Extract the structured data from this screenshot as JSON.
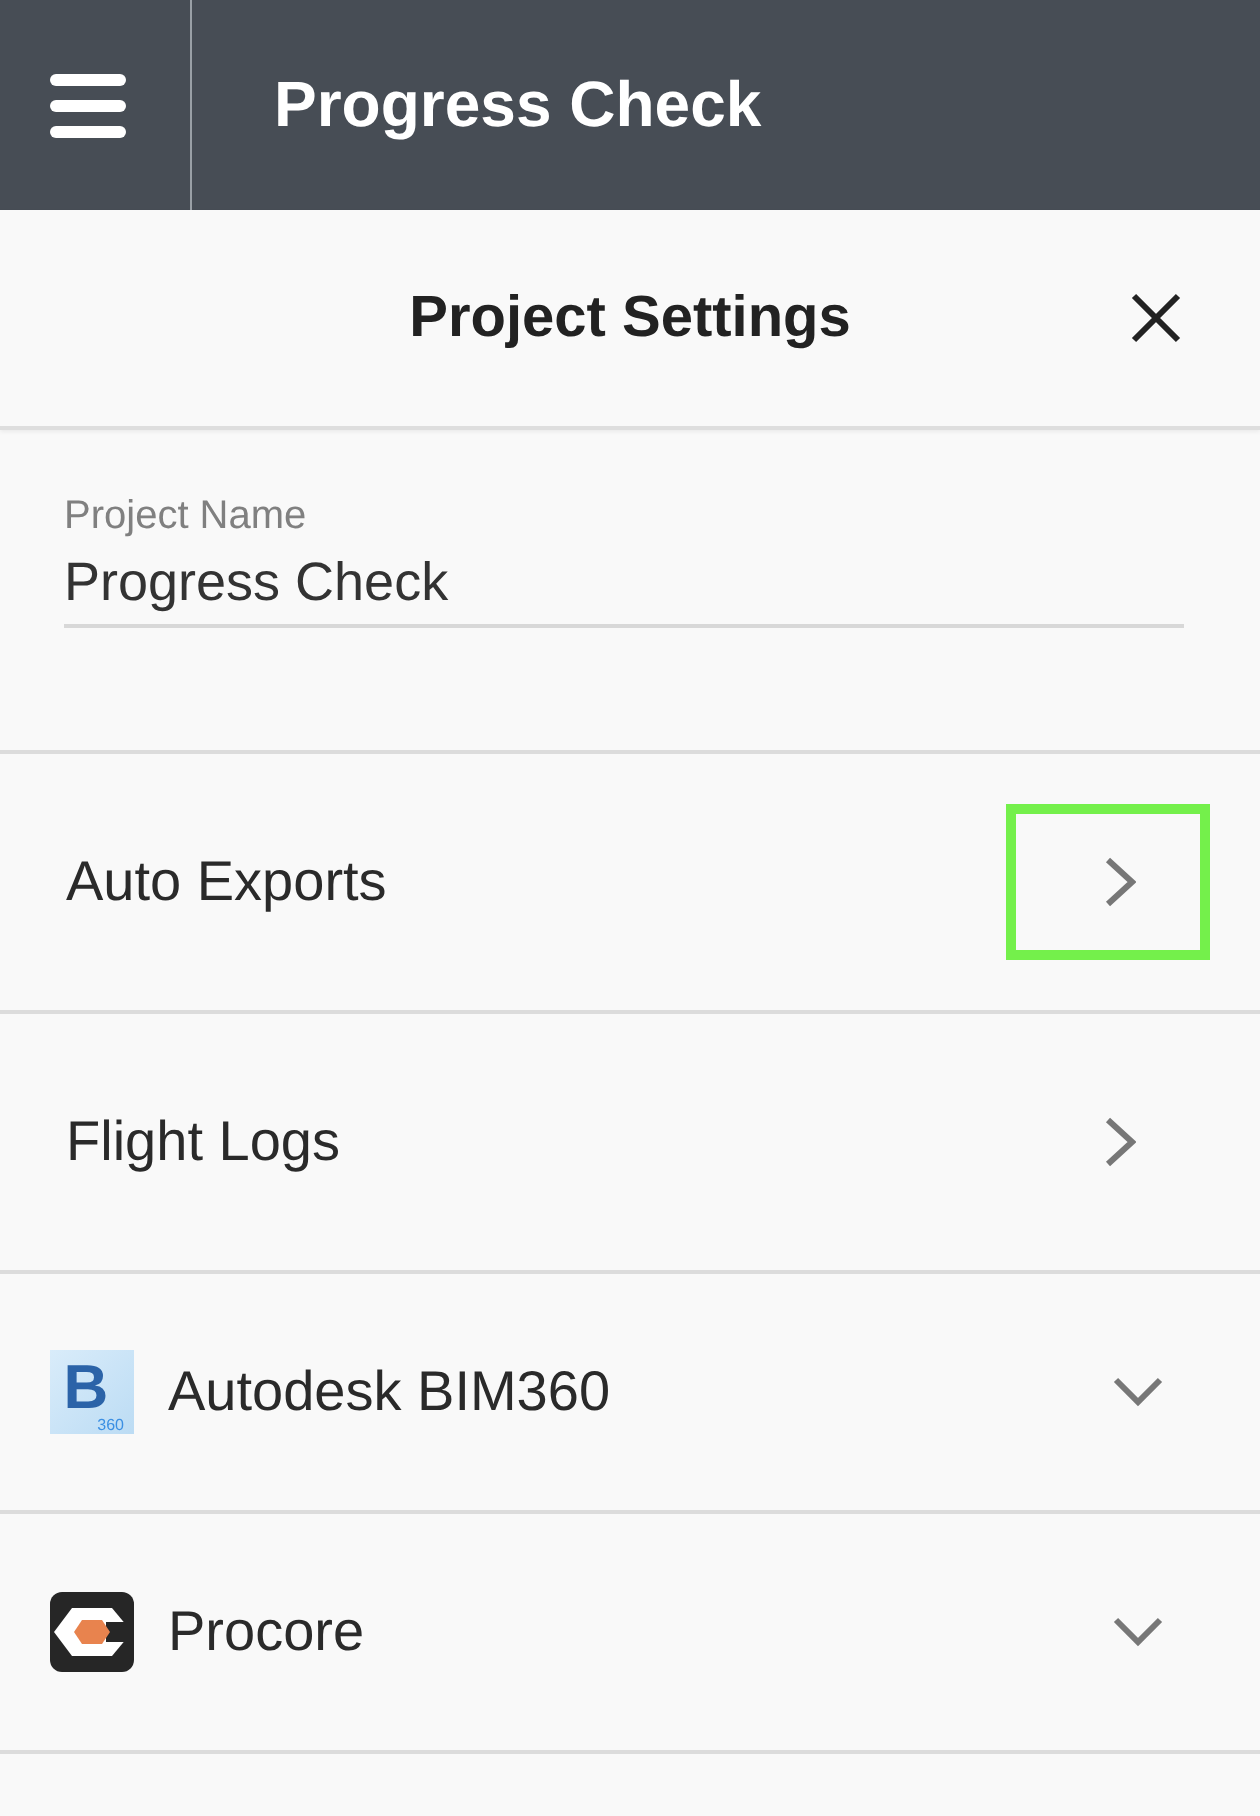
{
  "header": {
    "title": "Progress Check"
  },
  "panel": {
    "title": "Project Settings"
  },
  "project_name": {
    "label": "Project Name",
    "value": "Progress Check"
  },
  "items": [
    {
      "kind": "link",
      "label": "Auto Exports",
      "highlighted": true
    },
    {
      "kind": "link",
      "label": "Flight Logs",
      "highlighted": false
    },
    {
      "kind": "integration",
      "label": "Autodesk BIM360",
      "logo": {
        "kind": "letter-tile",
        "letter": "B",
        "caption": "360"
      },
      "expanded": false
    },
    {
      "kind": "integration",
      "label": "Procore",
      "logo": {
        "kind": "hexagon"
      },
      "expanded": false
    }
  ]
}
